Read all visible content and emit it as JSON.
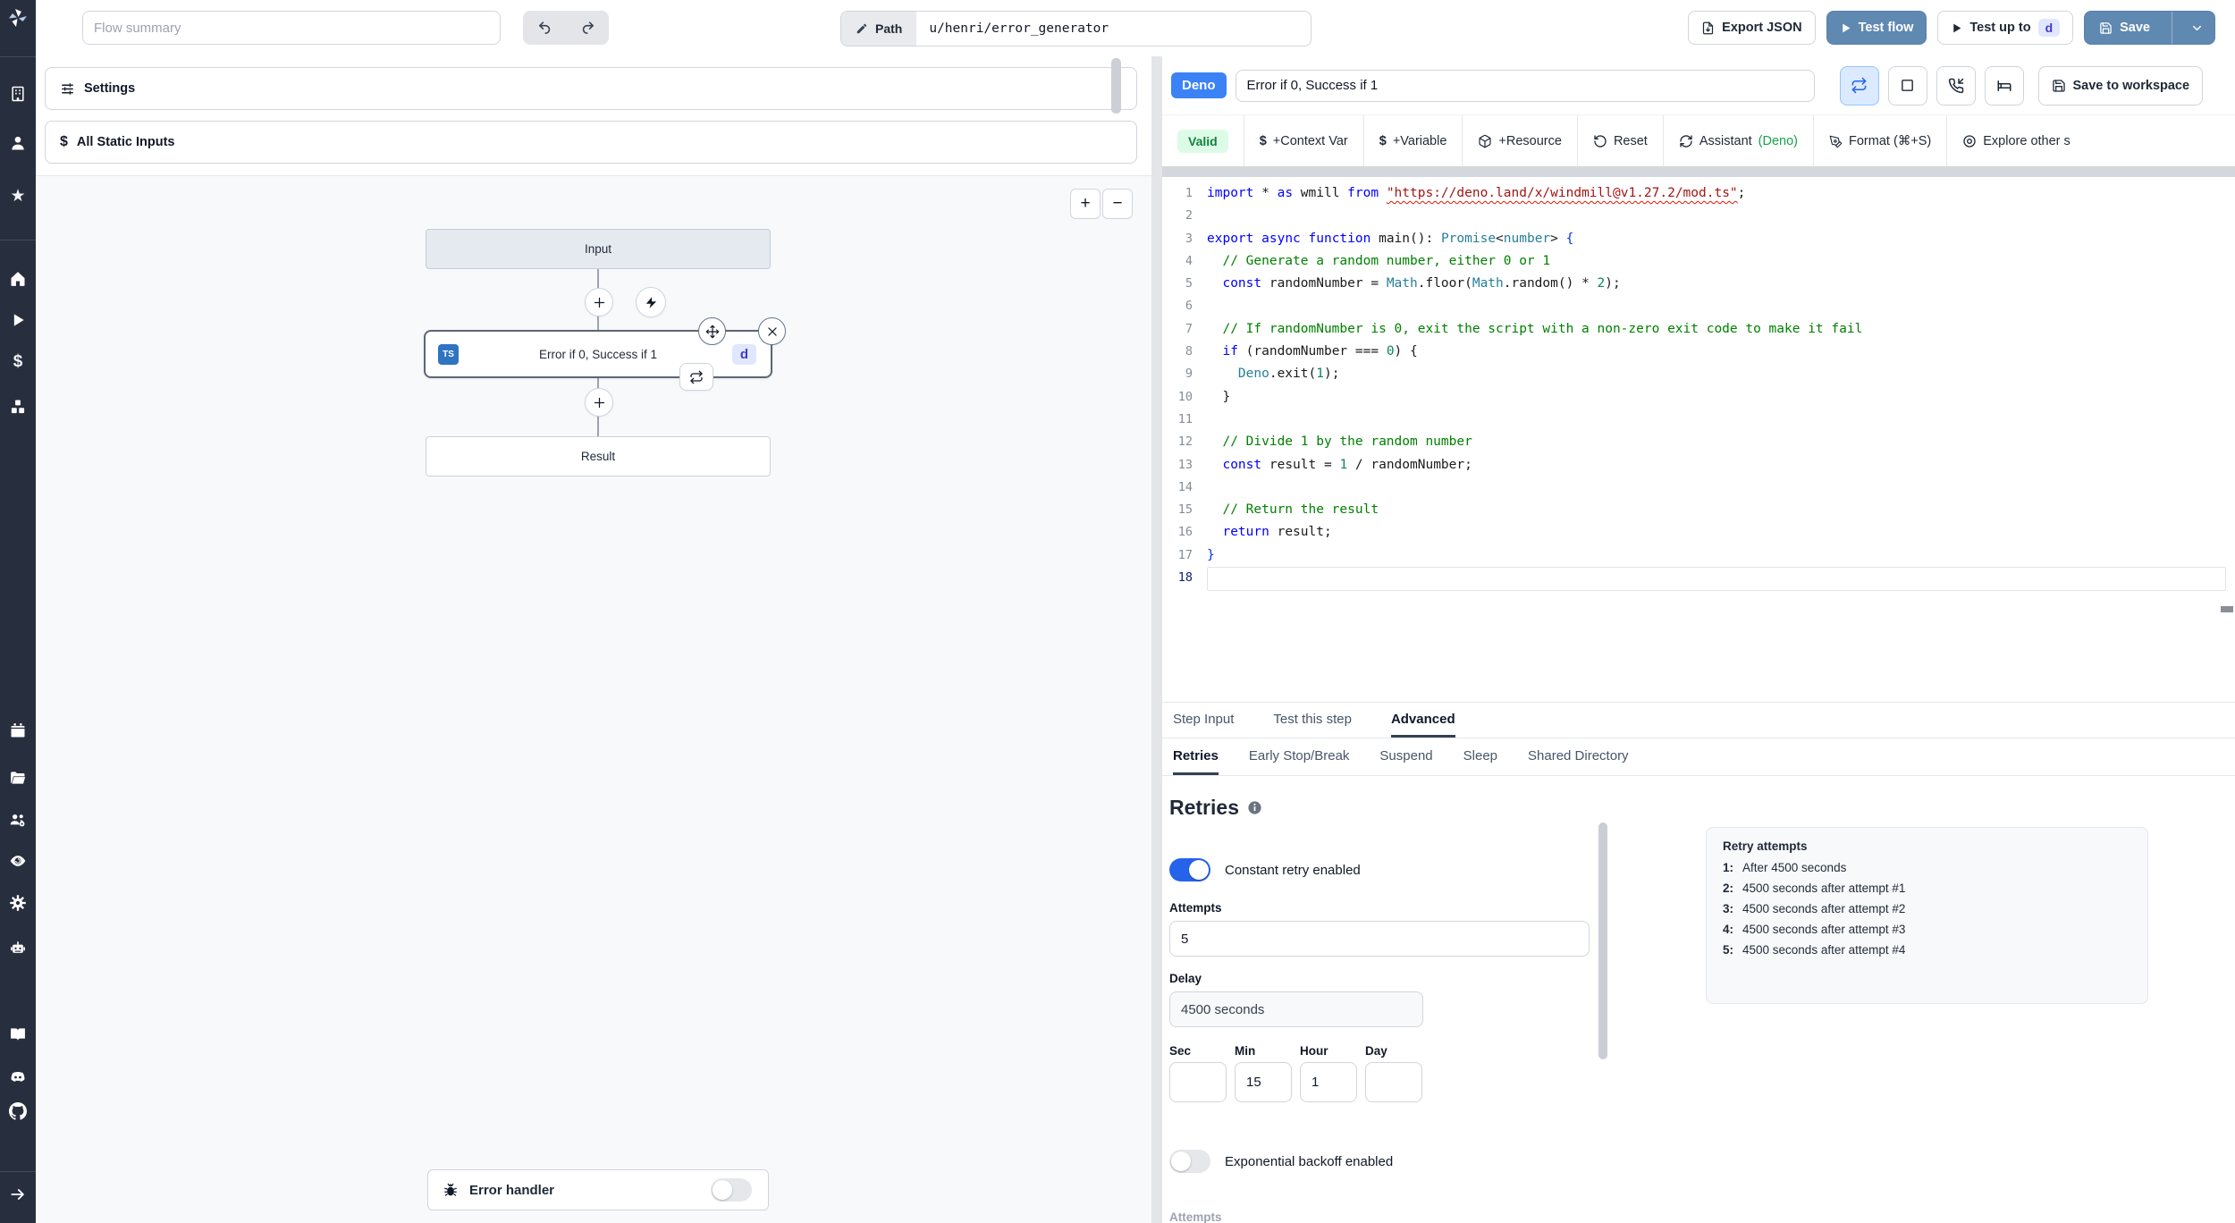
{
  "topbar": {
    "flow_summary_placeholder": "Flow summary",
    "path_label": "Path",
    "path_value": "u/henri/error_generator",
    "export_json": "Export JSON",
    "test_flow": "Test flow",
    "test_up_to": "Test up to",
    "test_up_to_badge": "d",
    "save": "Save"
  },
  "left": {
    "settings": "Settings",
    "static_inputs": "All Static Inputs",
    "graph": {
      "input_node": "Input",
      "step_node": "Error if 0, Success if 1",
      "step_lang_badge": "TS",
      "step_id_badge": "d",
      "result_node": "Result",
      "error_handler": "Error handler"
    }
  },
  "editor_header": {
    "lang_badge": "Deno",
    "title": "Error if 0, Success if 1",
    "save_to_workspace": "Save to workspace"
  },
  "toolbar": {
    "valid": "Valid",
    "context_var": "+Context Var",
    "variable": "+Variable",
    "resource": "+Resource",
    "reset": "Reset",
    "assistant": "Assistant ",
    "assistant_lang": "(Deno)",
    "format": "Format (⌘+S)",
    "explore": "Explore other s"
  },
  "editor": {
    "lines": [
      {
        "num": "1",
        "tokens": [
          [
            "kw",
            "import"
          ],
          [
            "pl",
            " * "
          ],
          [
            "kw",
            "as"
          ],
          [
            "pl",
            " wmill "
          ],
          [
            "kw",
            "from"
          ],
          [
            "pl",
            " "
          ],
          [
            "str sq",
            "\"https://deno.land/x/windmill@v1.27.2/mod.ts\""
          ],
          [
            "pl",
            ";"
          ]
        ]
      },
      {
        "num": "2",
        "tokens": []
      },
      {
        "num": "3",
        "tokens": [
          [
            "kw",
            "export"
          ],
          [
            "pl",
            " "
          ],
          [
            "kw",
            "async"
          ],
          [
            "pl",
            " "
          ],
          [
            "kw",
            "function"
          ],
          [
            "pl",
            " main(): "
          ],
          [
            "ty",
            "Promise"
          ],
          [
            "pl",
            "<"
          ],
          [
            "ty",
            "number"
          ],
          [
            "pl",
            "> "
          ],
          [
            "brk1",
            "{"
          ]
        ]
      },
      {
        "num": "4",
        "tokens": [
          [
            "pl",
            "  "
          ],
          [
            "cm",
            "// Generate a random number, either 0 or 1"
          ]
        ]
      },
      {
        "num": "5",
        "tokens": [
          [
            "pl",
            "  "
          ],
          [
            "kw",
            "const"
          ],
          [
            "pl",
            " randomNumber = "
          ],
          [
            "ty",
            "Math"
          ],
          [
            "pl",
            ".floor("
          ],
          [
            "ty",
            "Math"
          ],
          [
            "pl",
            ".random() * "
          ],
          [
            "num",
            "2"
          ],
          [
            "pl",
            ");"
          ]
        ]
      },
      {
        "num": "6",
        "tokens": []
      },
      {
        "num": "7",
        "tokens": [
          [
            "pl",
            "  "
          ],
          [
            "cm",
            "// If randomNumber is 0, exit the script with a non-zero exit code to make it fail"
          ]
        ]
      },
      {
        "num": "8",
        "tokens": [
          [
            "pl",
            "  "
          ],
          [
            "kw",
            "if"
          ],
          [
            "pl",
            " (randomNumber === "
          ],
          [
            "num",
            "0"
          ],
          [
            "pl",
            ") {"
          ]
        ]
      },
      {
        "num": "9",
        "tokens": [
          [
            "pl",
            "    "
          ],
          [
            "ty",
            "Deno"
          ],
          [
            "pl",
            ".exit("
          ],
          [
            "num",
            "1"
          ],
          [
            "pl",
            ");"
          ]
        ]
      },
      {
        "num": "10",
        "tokens": [
          [
            "pl",
            "  }"
          ]
        ]
      },
      {
        "num": "11",
        "tokens": []
      },
      {
        "num": "12",
        "tokens": [
          [
            "pl",
            "  "
          ],
          [
            "cm",
            "// Divide 1 by the random number"
          ]
        ]
      },
      {
        "num": "13",
        "tokens": [
          [
            "pl",
            "  "
          ],
          [
            "kw",
            "const"
          ],
          [
            "pl",
            " result = "
          ],
          [
            "num",
            "1"
          ],
          [
            "pl",
            " / randomNumber;"
          ]
        ]
      },
      {
        "num": "14",
        "tokens": []
      },
      {
        "num": "15",
        "tokens": [
          [
            "pl",
            "  "
          ],
          [
            "cm",
            "// Return the result"
          ]
        ]
      },
      {
        "num": "16",
        "tokens": [
          [
            "pl",
            "  "
          ],
          [
            "kw",
            "return"
          ],
          [
            "pl",
            " result;"
          ]
        ]
      },
      {
        "num": "17",
        "tokens": [
          [
            "brk1",
            "}"
          ]
        ]
      },
      {
        "num": "18",
        "current": true,
        "tokens": []
      }
    ]
  },
  "tabs": {
    "main": [
      {
        "label": "Step Input"
      },
      {
        "label": "Test this step"
      },
      {
        "label": "Advanced"
      }
    ],
    "sub": [
      {
        "label": "Retries"
      },
      {
        "label": "Early Stop/Break"
      },
      {
        "label": "Suspend"
      },
      {
        "label": "Sleep"
      },
      {
        "label": "Shared Directory"
      }
    ]
  },
  "retries": {
    "heading": "Retries",
    "constant_toggle_label": "Constant retry enabled",
    "attempts_label": "Attempts",
    "attempts_value": "5",
    "delay_label": "Delay",
    "delay_value": "4500 seconds",
    "sec_label": "Sec",
    "min_label": "Min",
    "hour_label": "Hour",
    "day_label": "Day",
    "sec_value": "",
    "min_value": "15",
    "hour_value": "1",
    "day_value": "",
    "backoff_toggle_label": "Exponential backoff enabled",
    "attempts_cut_label": "Attempts"
  },
  "retry_info": {
    "title": "Retry attempts",
    "items": [
      {
        "num": "1:",
        "text": "After 4500 seconds"
      },
      {
        "num": "2:",
        "text": "4500 seconds after attempt #1"
      },
      {
        "num": "3:",
        "text": "4500 seconds after attempt #2"
      },
      {
        "num": "4:",
        "text": "4500 seconds after attempt #3"
      },
      {
        "num": "5:",
        "text": "4500 seconds after attempt #4"
      }
    ]
  },
  "icons": {
    "dollar_glyph": "$",
    "zoom_in_glyph": "+",
    "zoom_out_glyph": "−",
    "star_glyph": "★"
  },
  "colors": {
    "accent_steel_blue": "#6089b2",
    "lang_badge_blue": "#3b82f6",
    "valid_green_bg": "#dcfce7",
    "valid_green_text": "#15803d",
    "toggle_on_blue": "#2563eb",
    "sidebar_dark": "#272e3d",
    "id_badge_bg": "#e0e7ff",
    "id_badge_text": "#4338ca"
  }
}
